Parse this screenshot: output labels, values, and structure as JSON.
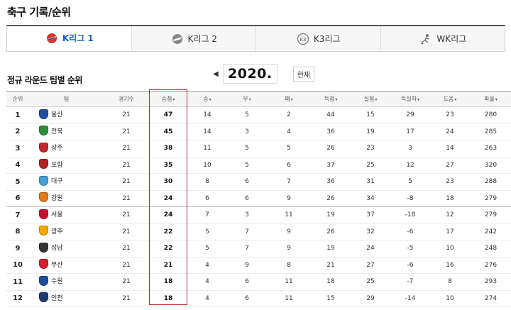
{
  "page_title": "축구 기록/순위",
  "tabs": [
    {
      "label": "K리그 1",
      "icon": "kleague1-icon",
      "active": true
    },
    {
      "label": "K리그 2",
      "icon": "kleague2-icon",
      "active": false
    },
    {
      "label": "K3리그",
      "icon": "k3league-icon",
      "active": false
    },
    {
      "label": "WK리그",
      "icon": "wkleague-icon",
      "active": false
    }
  ],
  "section_title": "정규 라운드 팀별 순위",
  "year_nav": {
    "prev": "◀",
    "year": "2020.",
    "now_button": "현재"
  },
  "columns": [
    "순위",
    "팀",
    "경기수",
    "승점",
    "승",
    "무",
    "패",
    "득점",
    "실점",
    "득실차",
    "도움",
    "파울"
  ],
  "sort_arrow": "▾",
  "rows": [
    {
      "rank": "1",
      "team": "울산",
      "color": "#1f4ea3",
      "gp": "21",
      "pts": "47",
      "w": "14",
      "d": "5",
      "l": "2",
      "gf": "44",
      "ga": "15",
      "gd": "29",
      "ast": "23",
      "fouls": "280"
    },
    {
      "rank": "2",
      "team": "전북",
      "color": "#2e8b3d",
      "gp": "21",
      "pts": "45",
      "w": "14",
      "d": "3",
      "l": "4",
      "gf": "36",
      "ga": "19",
      "gd": "17",
      "ast": "24",
      "fouls": "285"
    },
    {
      "rank": "3",
      "team": "상주",
      "color": "#c0282d",
      "gp": "21",
      "pts": "38",
      "w": "11",
      "d": "5",
      "l": "5",
      "gf": "26",
      "ga": "23",
      "gd": "3",
      "ast": "14",
      "fouls": "263"
    },
    {
      "rank": "4",
      "team": "포항",
      "color": "#b22222",
      "gp": "21",
      "pts": "35",
      "w": "10",
      "d": "5",
      "l": "6",
      "gf": "37",
      "ga": "25",
      "gd": "12",
      "ast": "27",
      "fouls": "320"
    },
    {
      "rank": "5",
      "team": "대구",
      "color": "#4a9fd8",
      "gp": "21",
      "pts": "30",
      "w": "8",
      "d": "6",
      "l": "7",
      "gf": "36",
      "ga": "31",
      "gd": "5",
      "ast": "23",
      "fouls": "288"
    },
    {
      "rank": "6",
      "team": "강원",
      "color": "#e07b20",
      "gp": "21",
      "pts": "24",
      "w": "6",
      "d": "6",
      "l": "9",
      "gf": "26",
      "ga": "34",
      "gd": "-8",
      "ast": "18",
      "fouls": "279"
    },
    {
      "rank": "7",
      "team": "서울",
      "color": "#c8102e",
      "gp": "21",
      "pts": "24",
      "w": "7",
      "d": "3",
      "l": "11",
      "gf": "19",
      "ga": "37",
      "gd": "-18",
      "ast": "12",
      "fouls": "279"
    },
    {
      "rank": "8",
      "team": "광주",
      "color": "#f2a900",
      "gp": "21",
      "pts": "22",
      "w": "5",
      "d": "7",
      "l": "9",
      "gf": "26",
      "ga": "32",
      "gd": "-6",
      "ast": "17",
      "fouls": "242"
    },
    {
      "rank": "9",
      "team": "성남",
      "color": "#333333",
      "gp": "21",
      "pts": "22",
      "w": "5",
      "d": "7",
      "l": "9",
      "gf": "19",
      "ga": "24",
      "gd": "-5",
      "ast": "10",
      "fouls": "248"
    },
    {
      "rank": "10",
      "team": "부산",
      "color": "#d41f2f",
      "gp": "21",
      "pts": "21",
      "w": "4",
      "d": "9",
      "l": "8",
      "gf": "21",
      "ga": "27",
      "gd": "-6",
      "ast": "16",
      "fouls": "276"
    },
    {
      "rank": "11",
      "team": "수원",
      "color": "#1b4f9c",
      "gp": "21",
      "pts": "18",
      "w": "4",
      "d": "6",
      "l": "11",
      "gf": "18",
      "ga": "25",
      "gd": "-7",
      "ast": "8",
      "fouls": "293"
    },
    {
      "rank": "12",
      "team": "인천",
      "color": "#1e3a73",
      "gp": "21",
      "pts": "18",
      "w": "4",
      "d": "6",
      "l": "11",
      "gf": "15",
      "ga": "29",
      "gd": "-14",
      "ast": "10",
      "fouls": "274"
    }
  ]
}
